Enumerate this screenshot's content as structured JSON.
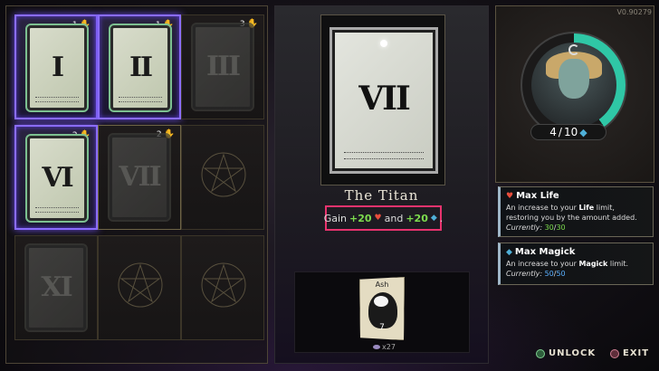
{
  "version": "V0.90279",
  "grid": {
    "slots": [
      {
        "numeral": "I",
        "count": "1",
        "state": "selected",
        "kind": "card"
      },
      {
        "numeral": "II",
        "count": "1",
        "state": "selected",
        "kind": "card"
      },
      {
        "numeral": "III",
        "count": "3",
        "state": "locked",
        "kind": "card"
      },
      {
        "numeral": "VI",
        "count": "2",
        "state": "selected",
        "kind": "card"
      },
      {
        "numeral": "VII",
        "count": "2",
        "state": "highlighted",
        "kind": "card"
      },
      {
        "numeral": "",
        "count": "",
        "state": "empty",
        "kind": "pentagram"
      },
      {
        "numeral": "XI",
        "count": "",
        "state": "locked",
        "kind": "card"
      },
      {
        "numeral": "",
        "count": "",
        "state": "empty",
        "kind": "pentagram"
      },
      {
        "numeral": "",
        "count": "",
        "state": "empty",
        "kind": "pentagram"
      }
    ]
  },
  "selected_card": {
    "numeral": "VII",
    "name": "The Titan",
    "desc_gain": "Gain",
    "desc_life": "+20",
    "desc_and": "and",
    "desc_magick": "+20",
    "desc_end": "."
  },
  "resource": {
    "name": "Ash",
    "cost": "7",
    "owned": "x27"
  },
  "character": {
    "magick_current": "4",
    "magick_sep": "/",
    "magick_max": "10",
    "ring_fill": 0.4
  },
  "boons": [
    {
      "title": "Max Life",
      "icon": "heart-icon",
      "text_1": "An increase to your ",
      "bold": "Life",
      "text_2": " limit, restoring you by the amount added. ",
      "currently": "Currently:",
      "cur": "30",
      "sep": "/",
      "max": "30",
      "accent": "#7ddc4e"
    },
    {
      "title": "Max Magick",
      "icon": "drop-icon",
      "text_1": "An increase to your ",
      "bold": "Magick",
      "text_2": " limit.",
      "currently": "Currently:",
      "cur": "50",
      "sep": "/",
      "max": "50",
      "accent": "#5ab0ff"
    }
  ],
  "actions": {
    "unlock": "UNLOCK",
    "exit": "EXIT"
  },
  "colors": {
    "selection": "#8a6cff",
    "highlight_box": "#e8336e",
    "magick_ring": "#2fc7a6"
  }
}
